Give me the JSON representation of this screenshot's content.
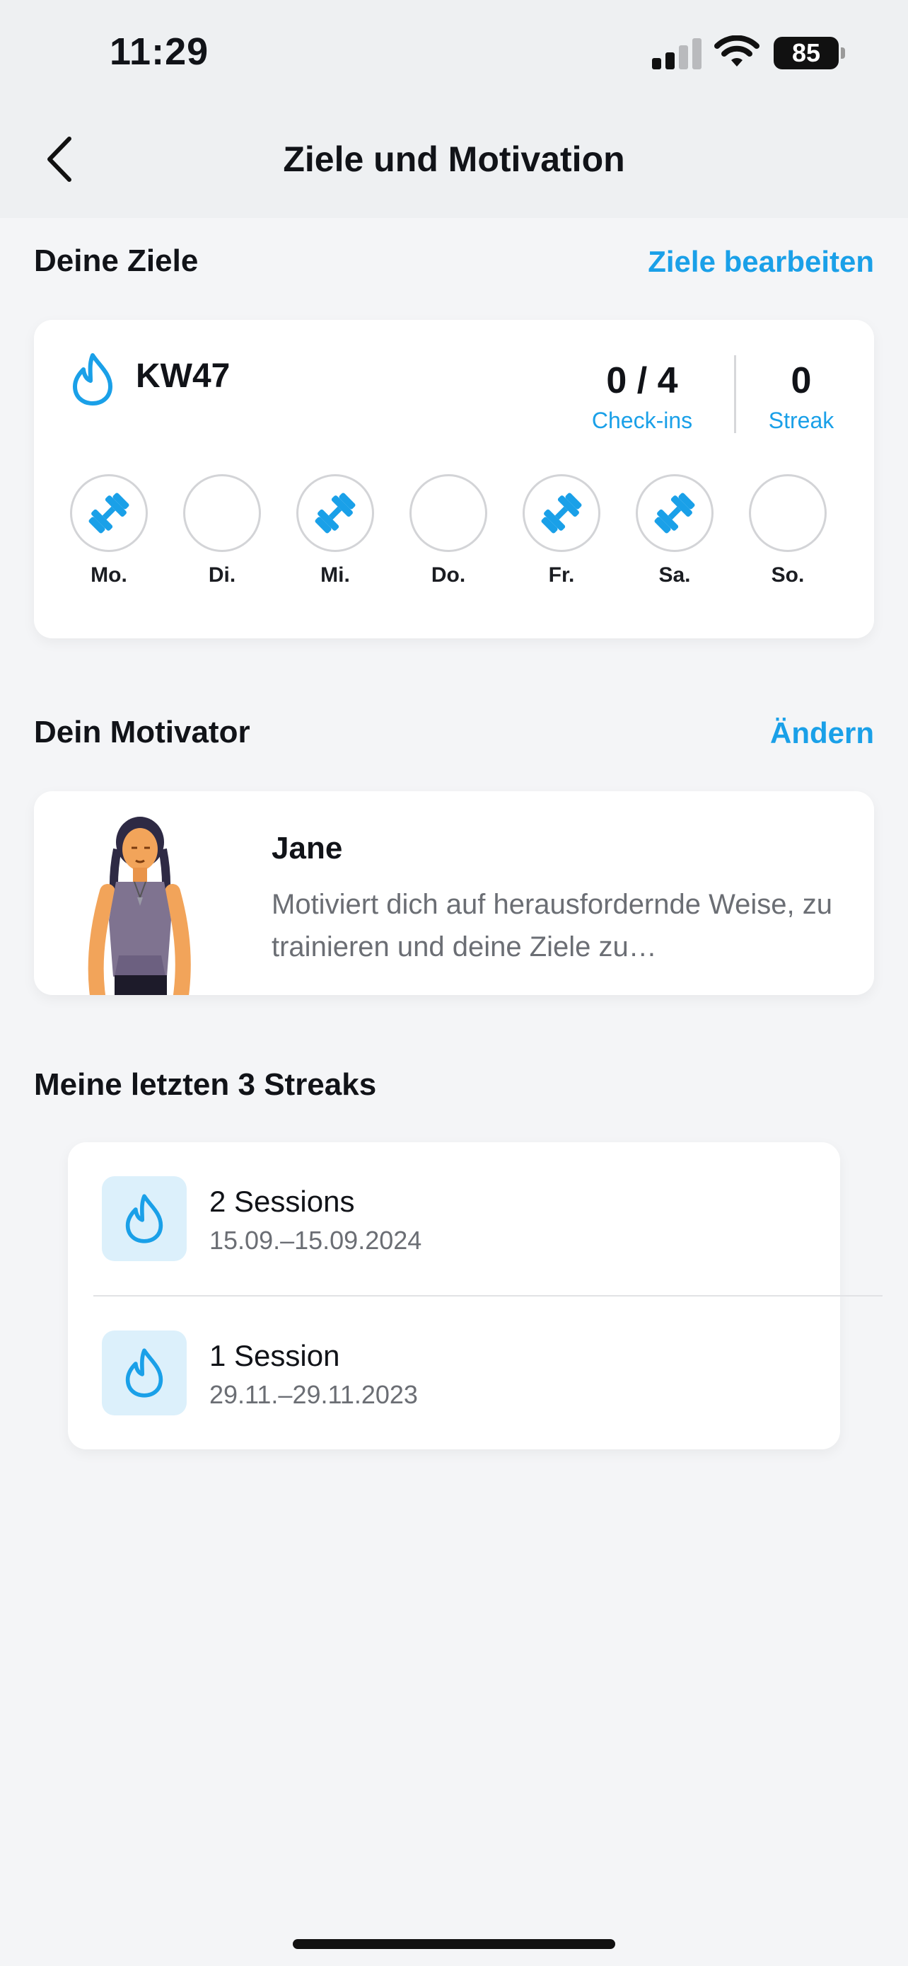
{
  "status_bar": {
    "time": "11:29",
    "battery": "85"
  },
  "nav": {
    "title": "Ziele und Motivation",
    "back_icon": "chevron-left-icon"
  },
  "goals_section": {
    "title": "Deine Ziele",
    "edit_link": "Ziele bearbeiten",
    "week": "KW47",
    "checkins_value": "0 / 4",
    "checkins_label": "Check-ins",
    "streak_value": "0",
    "streak_label": "Streak",
    "days": [
      {
        "label": "Mo.",
        "done": true
      },
      {
        "label": "Di.",
        "done": false
      },
      {
        "label": "Mi.",
        "done": true
      },
      {
        "label": "Do.",
        "done": false
      },
      {
        "label": "Fr.",
        "done": true
      },
      {
        "label": "Sa.",
        "done": true
      },
      {
        "label": "So.",
        "done": false
      }
    ]
  },
  "motivator_section": {
    "title": "Dein Motivator",
    "change_link": "Ändern",
    "name": "Jane",
    "description": "Motiviert dich auf herausfordernde Weise, zu trainieren und deine Ziele zu…"
  },
  "streaks_section": {
    "title": "Meine letzten 3 Streaks",
    "items": [
      {
        "title": "2 Sessions",
        "dates": "15.09.–15.09.2024"
      },
      {
        "title": "1 Session",
        "dates": "29.11.–29.11.2023"
      }
    ]
  },
  "colors": {
    "accent": "#1aa0e8",
    "background": "#f4f5f7",
    "icon_bg": "#dcf0fb"
  }
}
